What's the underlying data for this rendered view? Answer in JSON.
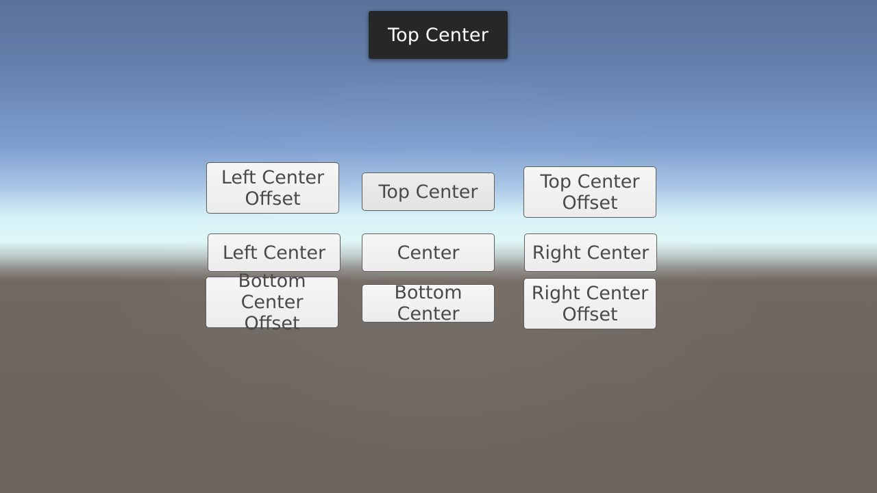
{
  "toast": {
    "text": "Top Center"
  },
  "buttons": {
    "left_center_offset": "Left Center\nOffset",
    "top_center": "Top Center",
    "top_center_offset": "Top Center\nOffset",
    "left_center": "Left Center",
    "center": "Center",
    "right_center": "Right Center",
    "bottom_center_offset": "Bottom Center\nOffset",
    "bottom_center": "Bottom Center",
    "right_center_offset": "Right Center\nOffset"
  }
}
